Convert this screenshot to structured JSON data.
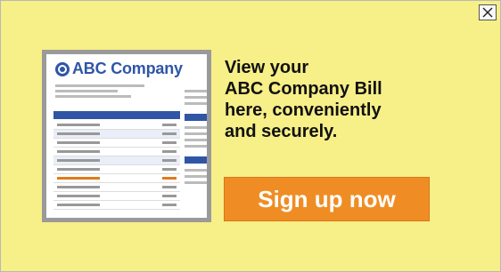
{
  "ad": {
    "close_icon": "close-icon",
    "bill_logo_text": "ABC Company",
    "headline_lines": [
      "View your",
      "ABC Company Bill",
      "here, conveniently",
      "and securely."
    ],
    "cta_label": "Sign up now",
    "colors": {
      "background": "#f7ef87",
      "brand_blue": "#2f56a6",
      "cta_orange": "#ef8d24"
    }
  }
}
